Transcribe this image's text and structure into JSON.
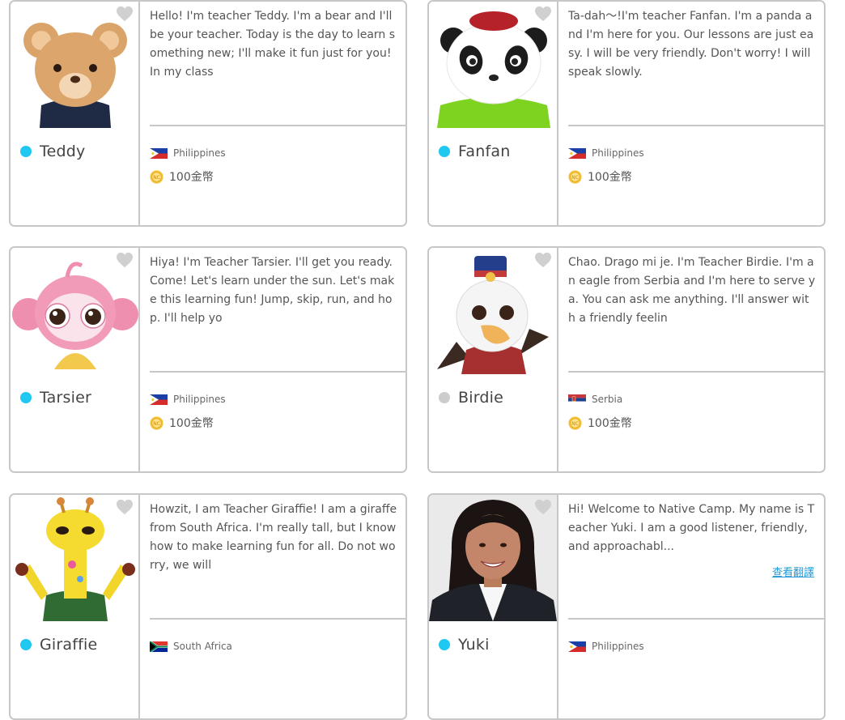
{
  "colors": {
    "border": "#c8c8c8",
    "status_online": "#1ec8f0",
    "status_offline": "#cccccc",
    "link": "#1e9bd7",
    "coin": "#f4c23a",
    "heart": "#d0d0d0"
  },
  "teachers": [
    {
      "name": "Teddy",
      "status": "online",
      "bio": "Hello! I'm teacher Teddy. I'm a bear and I'll be your teacher. Today is the day to learn something new; I'll make it fun just for you! In my class",
      "country": "Philippines",
      "price": "100金幣",
      "avatar_icon": "bear-character-icon",
      "favorite_icon": "heart-icon"
    },
    {
      "name": "Fanfan",
      "status": "online",
      "bio": "Ta-dah～!I'm teacher Fanfan. I'm a panda and I'm here for you. Our lessons are just easy. I will be very friendly. Don't worry! I will speak slowly.",
      "country": "Philippines",
      "price": "100金幣",
      "avatar_icon": "panda-character-icon",
      "favorite_icon": "heart-icon"
    },
    {
      "name": "Tarsier",
      "status": "online",
      "bio": "Hiya! I'm Teacher Tarsier. I'll get you ready. Come! Let's learn under the sun. Let's make this learning fun! Jump, skip, run, and hop. I'll help yo",
      "country": "Philippines",
      "price": "100金幣",
      "avatar_icon": "tarsier-character-icon",
      "favorite_icon": "heart-icon"
    },
    {
      "name": "Birdie",
      "status": "offline",
      "bio": "Chao. Drago mi je. I'm Teacher Birdie. I'm an eagle from Serbia and I'm here to serve ya. You can ask me anything. I'll answer with a friendly feelin",
      "country": "Serbia",
      "price": "100金幣",
      "avatar_icon": "eagle-character-icon",
      "favorite_icon": "heart-icon"
    },
    {
      "name": "Giraffie",
      "status": "online",
      "bio": "Howzit, I am Teacher Giraffie! I am a giraffe from South Africa. I'm really tall, but I know how to make learning fun for all. Do not worry, we will",
      "country": "South Africa",
      "price": "",
      "avatar_icon": "giraffe-character-icon",
      "favorite_icon": "heart-icon"
    },
    {
      "name": "Yuki",
      "status": "online",
      "bio": "Hi! Welcome to Native Camp. My name is Teacher Yuki. I am a good listener, friendly, and approachabl...",
      "translate_label": "查看翻譯",
      "country": "Philippines",
      "price": "",
      "avatar_icon": "teacher-photo-icon",
      "favorite_icon": "heart-icon"
    }
  ]
}
